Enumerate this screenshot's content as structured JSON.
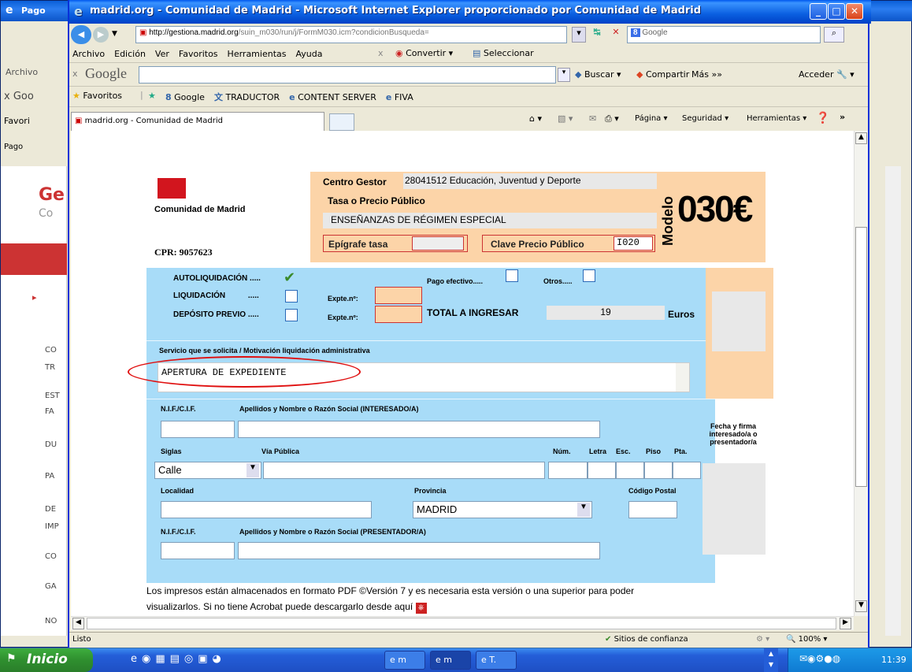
{
  "bg": {
    "title": "Pago",
    "sidebar": [
      "CO",
      "TR",
      "EST",
      "FA",
      "DU",
      "PA",
      "DE",
      "IMP",
      "CO",
      "GA",
      "NO"
    ],
    "google": "Goo",
    "fav": "Favori",
    "tab": "Pago",
    "menu": "Archivo",
    "big": "Ge",
    "small": "Co"
  },
  "window": {
    "title": "madrid.org - Comunidad de Madrid - Microsoft Internet Explorer proporcionado por Comunidad de Madrid"
  },
  "address": {
    "url_host": "http://gestiona.madrid.org",
    "url_path": "/suin_m030/run/j/FormM030.icm?condicionBusqueda=",
    "search_engine": "Google"
  },
  "menu": [
    "Archivo",
    "Edición",
    "Ver",
    "Favoritos",
    "Herramientas",
    "Ayuda"
  ],
  "menu_extra": {
    "close": "x",
    "convert": "Convertir",
    "select": "Seleccionar"
  },
  "googlebar": {
    "x": "x",
    "logo": "Google",
    "buscar": "Buscar",
    "compartir": "Compartir",
    "mas": "Más »»",
    "acceder": "Acceder"
  },
  "favbar": {
    "favoritos": "Favoritos",
    "items": [
      "Google",
      "TRADUCTOR",
      "CONTENT SERVER",
      "FIVA"
    ]
  },
  "tab": {
    "label": "madrid.org - Comunidad de Madrid"
  },
  "cmd": {
    "pagina": "Página",
    "seguridad": "Seguridad",
    "herramientas": "Herramientas",
    "more": "»"
  },
  "form": {
    "brand": "Comunidad de Madrid",
    "cpr": "CPR: 9057623",
    "centro_label": "Centro Gestor",
    "centro_value": "28041512 Educación, Juventud y Deporte",
    "tasa_label": "Tasa o Precio Público",
    "tasa_value": "ENSEÑANZAS DE RÉGIMEN ESPECIAL",
    "epigrafe": "Epígrafe tasa",
    "clave": "Clave Precio Público",
    "clave_value": "I020",
    "modelo": "Modelo",
    "modelo_num": "030€",
    "autoliq": "AUTOLIQUIDACIÓN",
    "liq": "LIQUIDACIÓN",
    "deposito": "DEPÓSITO PREVIO",
    "dots": ".....",
    "pago": "Pago efectivo.....",
    "otros": "Otros.....",
    "expte": "Expte.nº:",
    "total_label": "TOTAL A INGRESAR",
    "total_value": "19",
    "euros": "Euros",
    "servicio_label": "Servicio que se solicita / Motivación liquidación administrativa",
    "servicio_value": "APERTURA DE EXPEDIENTE",
    "nif": "N.I.F./C.I.F.",
    "apellidos_int": "Apellidos y Nombre o Razón Social (INTERESADO/A)",
    "fecha": "Fecha y firma interesado/a o presentador/a",
    "siglas": "Siglas",
    "via": "Vía Pública",
    "num": "Núm.",
    "letra": "Letra",
    "esc": "Esc.",
    "piso": "Piso",
    "pta": "Pta.",
    "siglas_value": "Calle",
    "localidad": "Localidad",
    "provincia": "Provincia",
    "provincia_value": "MADRID",
    "cp": "Código Postal",
    "apellidos_pre": "Apellidos y Nombre o Razón Social (PRESENTADOR/A)",
    "note1": "Los impresos están almacenados en formato PDF ©Versión 7 y es necesaria esta versión o una superior para poder",
    "note2": "visualizarlos. Si no tiene Acrobat puede descargarlo desde aquí"
  },
  "status": {
    "text": "Listo",
    "zone": "Sitios de confianza",
    "zoom": "100%"
  },
  "taskbar": {
    "start": "Inicio",
    "tasks": [
      "m",
      "m",
      "T."
    ],
    "clock": "11:39"
  }
}
